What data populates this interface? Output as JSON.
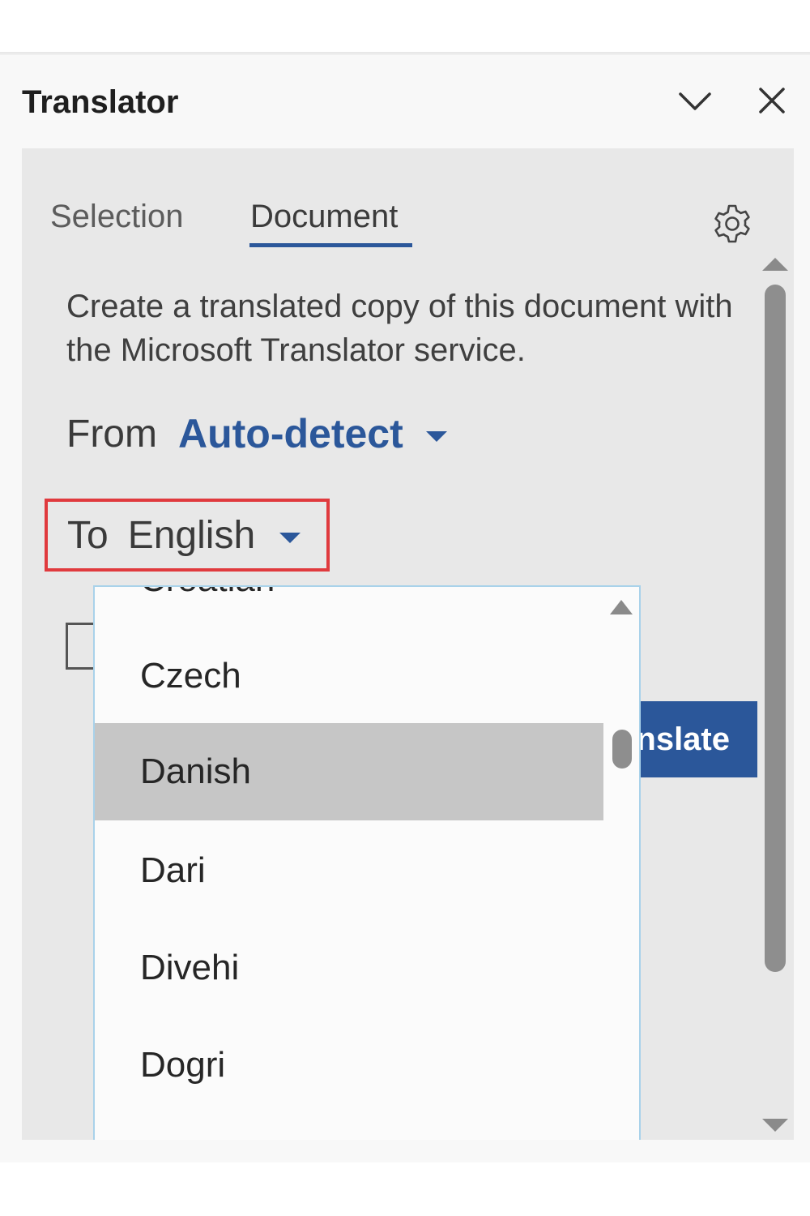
{
  "pane": {
    "title": "Translator"
  },
  "tabs": [
    {
      "label": "Selection",
      "active": false
    },
    {
      "label": "Document",
      "active": true
    }
  ],
  "description": "Create a translated copy of this document with the Microsoft Translator service.",
  "from": {
    "label": "From",
    "value": "Auto-detect"
  },
  "to": {
    "label": "To",
    "value": "English"
  },
  "translate_button": {
    "label": "nslate"
  },
  "dropdown": {
    "clipped_item": "Croatian",
    "items": [
      "Czech",
      "Danish",
      "Dari",
      "Divehi",
      "Dogri"
    ],
    "selected": "Danish"
  },
  "icons": {
    "collapse": "chevron-down-icon",
    "close": "close-icon",
    "settings": "gear-icon",
    "caret": "caret-down-icon"
  },
  "colors": {
    "accent": "#2b579a",
    "highlight_border": "#e03a3e",
    "dropdown_border": "#a9d2ea",
    "selected_item": "#c6c6c6"
  }
}
